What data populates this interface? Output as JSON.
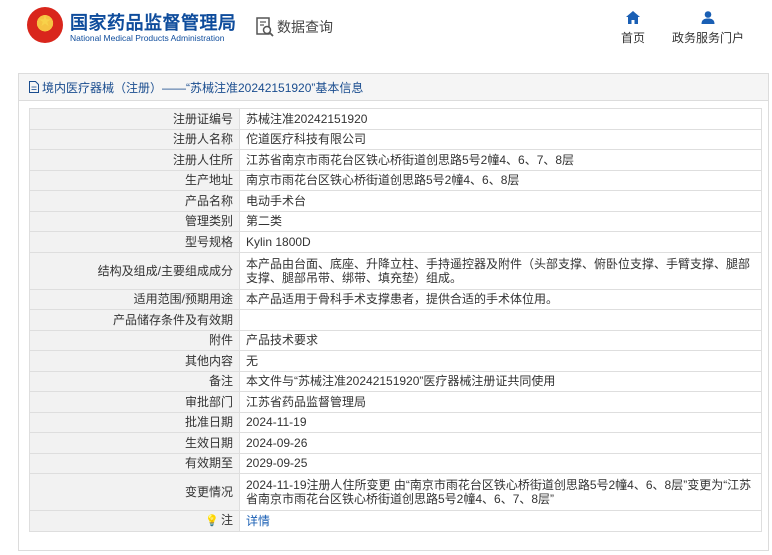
{
  "header": {
    "brand_cn": "国家药品监督管理局",
    "brand_en": "National Medical Products Administration",
    "query_label": "数据查询",
    "nav": {
      "home": "首页",
      "service": "政务服务门户"
    }
  },
  "panel": {
    "title": "境内医疗器械（注册）——“苏械注准20242151920”基本信息"
  },
  "rows": [
    {
      "label": "注册证编号",
      "value": "苏械注准20242151920"
    },
    {
      "label": "注册人名称",
      "value": "佗道医疗科技有限公司"
    },
    {
      "label": "注册人住所",
      "value": "江苏省南京市雨花台区铁心桥街道创思路5号2幢4、6、7、8层"
    },
    {
      "label": "生产地址",
      "value": "南京市雨花台区铁心桥街道创思路5号2幢4、6、8层"
    },
    {
      "label": "产品名称",
      "value": "电动手术台"
    },
    {
      "label": "管理类别",
      "value": "第二类"
    },
    {
      "label": "型号规格",
      "value": "Kylin 1800D"
    },
    {
      "label": "结构及组成/主要组成成分",
      "value": "本产品由台面、底座、升降立柱、手持遥控器及附件（头部支撑、俯卧位支撑、手臂支撑、腿部支撑、腿部吊带、绑带、填充垫）组成。"
    },
    {
      "label": "适用范围/预期用途",
      "value": "本产品适用于骨科手术支撑患者，提供合适的手术体位用。"
    },
    {
      "label": "产品储存条件及有效期",
      "value": ""
    },
    {
      "label": "附件",
      "value": "产品技术要求"
    },
    {
      "label": "其他内容",
      "value": "无"
    },
    {
      "label": "备注",
      "value": "本文件与“苏械注准20242151920”医疗器械注册证共同使用"
    },
    {
      "label": "审批部门",
      "value": "江苏省药品监督管理局"
    },
    {
      "label": "批准日期",
      "value": "2024-11-19"
    },
    {
      "label": "生效日期",
      "value": "2024-09-26"
    },
    {
      "label": "有效期至",
      "value": "2029-09-25"
    },
    {
      "label": "变更情况",
      "value": "2024-11-19注册人住所变更 由“南京市雨花台区铁心桥街道创思路5号2幢4、6、8层”变更为“江苏省南京市雨花台区铁心桥街道创思路5号2幢4、6、7、8层”"
    }
  ],
  "note": {
    "label": "注",
    "link": "详情"
  },
  "colors": {
    "brand_blue": "#0e4c9c",
    "link_blue": "#1a5fb4",
    "label_bg": "#f2f2f2"
  }
}
